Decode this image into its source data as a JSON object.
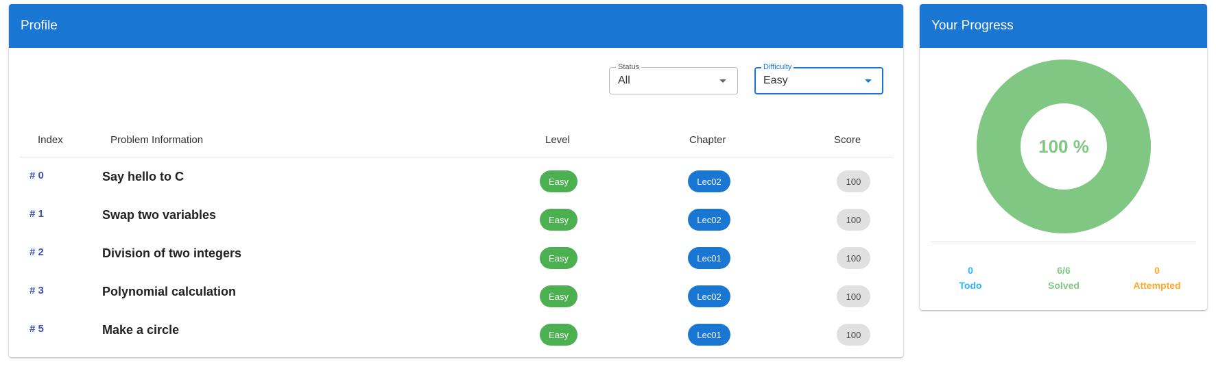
{
  "profile": {
    "title": "Profile",
    "filters": {
      "status": {
        "label": "Status",
        "value": "All"
      },
      "difficulty": {
        "label": "Difficulty",
        "value": "Easy"
      }
    },
    "table": {
      "headers": [
        "Index",
        "Problem Information",
        "Level",
        "Chapter",
        "Score"
      ],
      "rows": [
        {
          "index": "# 0",
          "name": "Say hello to C",
          "level": "Easy",
          "chapter": "Lec02",
          "score": "100"
        },
        {
          "index": "# 1",
          "name": "Swap two variables",
          "level": "Easy",
          "chapter": "Lec02",
          "score": "100"
        },
        {
          "index": "# 2",
          "name": "Division of two integers",
          "level": "Easy",
          "chapter": "Lec01",
          "score": "100"
        },
        {
          "index": "# 3",
          "name": "Polynomial calculation",
          "level": "Easy",
          "chapter": "Lec02",
          "score": "100"
        },
        {
          "index": "# 5",
          "name": "Make a circle",
          "level": "Easy",
          "chapter": "Lec01",
          "score": "100"
        }
      ]
    }
  },
  "progress": {
    "title": "Your Progress",
    "percent_label": "100 %",
    "solved_fraction": 1.0,
    "stats": {
      "todo": {
        "value": "0",
        "label": "Todo"
      },
      "solved": {
        "value": "6/6",
        "label": "Solved"
      },
      "attempted": {
        "value": "0",
        "label": "Attempted"
      }
    }
  },
  "colors": {
    "header": "#1976d2",
    "level_easy": "#4caf50",
    "chapter_chip": "#1976d2",
    "donut": "#81c784",
    "todo": "#29b6f6",
    "attempted": "#ffa726"
  }
}
